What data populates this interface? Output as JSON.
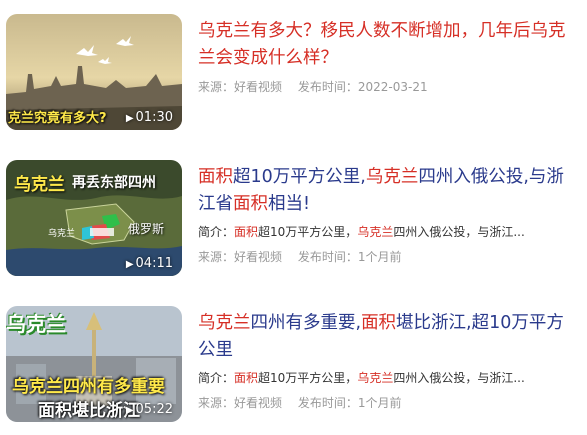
{
  "results": [
    {
      "thumb_caption": "克兰究竟有多大?",
      "duration": "01:30",
      "title_segments": [
        {
          "text": "乌克兰",
          "hl": true
        },
        {
          "text": "有多大？移民人数不断增加，几年后",
          "hl": true
        },
        {
          "text": "乌克兰",
          "hl": true
        },
        {
          "text": "会变成什么样？",
          "hl": true
        }
      ],
      "source": "来源：好看视频",
      "published": "发布时间：2022-03-21"
    },
    {
      "thumb_caption_left": "乌克兰",
      "thumb_caption_right": "再丢东部四州",
      "map_label_ukraine": "乌克兰",
      "map_label_russia": "俄罗斯",
      "duration": "04:11",
      "title_segments": [
        {
          "text": "面积",
          "hl": true
        },
        {
          "text": "超10万平方公里,",
          "hl": false
        },
        {
          "text": "乌克兰",
          "hl": true
        },
        {
          "text": "四州入俄公投,与浙江省",
          "hl": false
        },
        {
          "text": "面积",
          "hl": true
        },
        {
          "text": "相当!",
          "hl": false
        }
      ],
      "summary_segments": [
        {
          "text": "简介：",
          "hl": false
        },
        {
          "text": "面积",
          "hl": true
        },
        {
          "text": "超10万平方公里，",
          "hl": false
        },
        {
          "text": "乌克兰",
          "hl": true
        },
        {
          "text": "四州入俄公投，与浙江...",
          "hl": false
        }
      ],
      "source": "来源：好看视频",
      "published": "发布时间：1个月前"
    },
    {
      "thumb_caption_top": "乌克兰",
      "thumb_caption_line1": "乌克兰四州有多重要",
      "thumb_caption_line2": "面积堪比浙江",
      "duration": "05:22",
      "title_segments": [
        {
          "text": "乌克兰",
          "hl": true
        },
        {
          "text": "四州有多重要,",
          "hl": false
        },
        {
          "text": "面积",
          "hl": true
        },
        {
          "text": "堪比浙江,超10万平方公里",
          "hl": false
        }
      ],
      "summary_segments": [
        {
          "text": "简介：",
          "hl": false
        },
        {
          "text": "面积",
          "hl": true
        },
        {
          "text": "超10万平方公里，",
          "hl": false
        },
        {
          "text": "乌克兰",
          "hl": true
        },
        {
          "text": "四州入俄公投，与浙江...",
          "hl": false
        }
      ],
      "source": "来源：好看视频",
      "published": "发布时间：1个月前"
    }
  ]
}
